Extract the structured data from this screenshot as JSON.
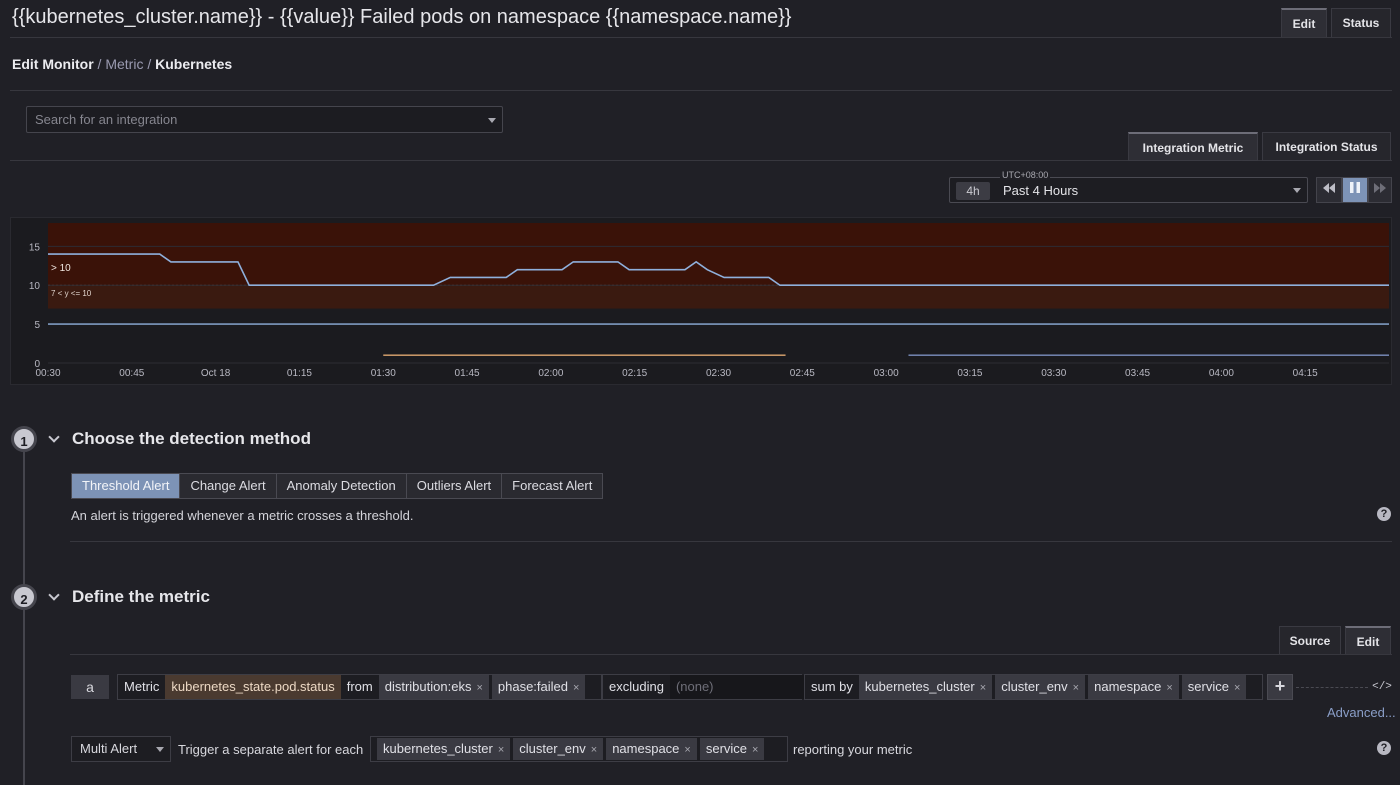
{
  "header": {
    "title": "{{kubernetes_cluster.name}} - {{value}} Failed pods on namespace {{namespace.name}}",
    "tab_edit": "Edit",
    "tab_status": "Status"
  },
  "breadcrumb": {
    "part1": "Edit Monitor",
    "sep": "/",
    "part2": "Metric",
    "part3": "Kubernetes"
  },
  "integration": {
    "search_placeholder": "Search for an integration",
    "tab_metric": "Integration Metric",
    "tab_status": "Integration Status"
  },
  "timeframe": {
    "timezone": "UTC+08:00",
    "short": "4h",
    "label": "Past 4 Hours"
  },
  "chart_data": {
    "type": "line",
    "y_ticks": [
      "15",
      "10",
      "5",
      "0"
    ],
    "ylim": [
      0,
      18
    ],
    "x_ticks": [
      "00:30",
      "00:45",
      "Oct 18",
      "01:15",
      "01:30",
      "01:45",
      "02:00",
      "02:15",
      "02:30",
      "02:45",
      "03:00",
      "03:15",
      "03:30",
      "03:45",
      "04:00",
      "04:15"
    ],
    "xlim": [
      0,
      240
    ],
    "grid": true,
    "annotations": {
      "alert_region": "> 10",
      "warning_region": "7 < y <= 10"
    },
    "thresholds": {
      "alert": 10,
      "warning": 7
    },
    "colors": {
      "alert_fill": "#3a1208",
      "warning_fill": "#3a1a10",
      "main_series": "#8fb0dc",
      "orange_series": "#e0a870",
      "blue_series": "#7c90c0"
    },
    "series": [
      {
        "x": [
          0,
          20,
          22,
          34,
          36,
          69,
          72,
          82,
          84,
          92,
          94,
          102,
          104,
          114,
          116,
          118,
          121,
          129,
          131,
          241
        ],
        "y": [
          14,
          14,
          13,
          13,
          10,
          10,
          11,
          11,
          12,
          12,
          13,
          13,
          12,
          12,
          13,
          12,
          11,
          11,
          10,
          10
        ]
      },
      {
        "x": [
          0,
          241
        ],
        "y": [
          5,
          5
        ]
      },
      {
        "x": [
          60,
          132
        ],
        "y": [
          1,
          1
        ]
      },
      {
        "x": [
          154,
          241
        ],
        "y": [
          1,
          1
        ]
      }
    ]
  },
  "section1": {
    "number": "1",
    "title": "Choose the detection method",
    "methods": [
      "Threshold Alert",
      "Change Alert",
      "Anomaly Detection",
      "Outliers Alert",
      "Forecast Alert"
    ],
    "selected": "Threshold Alert",
    "description": "An alert is triggered whenever a metric crosses a threshold."
  },
  "section2": {
    "number": "2",
    "title": "Define the metric",
    "tab_source": "Source",
    "tab_edit": "Edit",
    "query": {
      "letter": "a",
      "metric_label": "Metric",
      "metric_value": "kubernetes_state.pod.status",
      "from_label": "from",
      "from_tags": [
        "distribution:eks",
        "phase:failed"
      ],
      "excluding_label": "excluding",
      "excluding_placeholder": "(none)",
      "sumby_label": "sum by",
      "sumby_tags": [
        "kubernetes_cluster",
        "cluster_env",
        "namespace",
        "service"
      ],
      "advanced": "Advanced..."
    },
    "multi_alert": {
      "mode": "Multi Alert",
      "prefix": "Trigger a separate alert for each",
      "tags": [
        "kubernetes_cluster",
        "cluster_env",
        "namespace",
        "service"
      ],
      "suffix": "reporting your metric"
    }
  }
}
